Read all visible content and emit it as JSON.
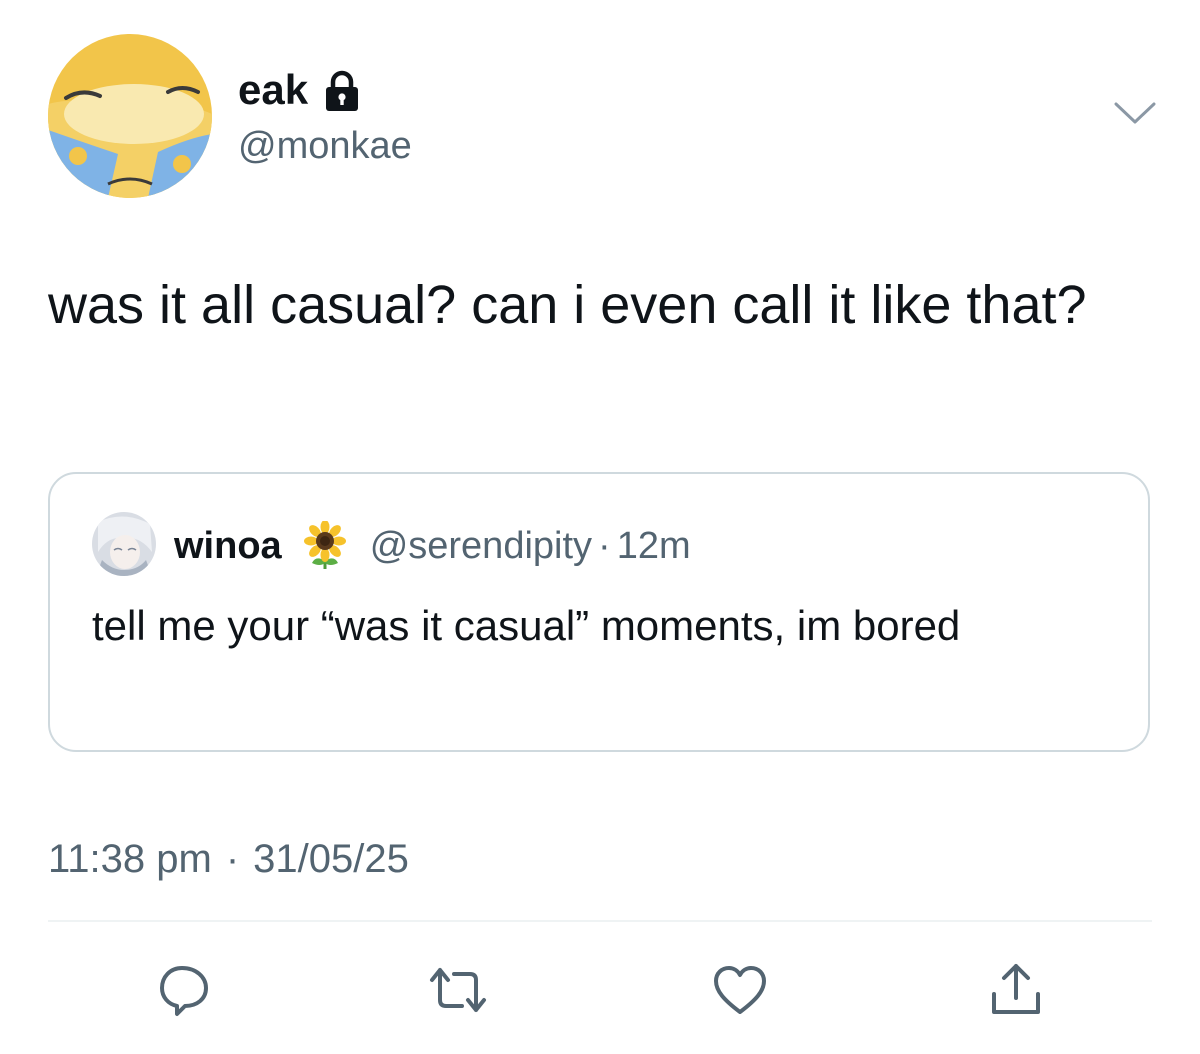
{
  "tweet": {
    "author": {
      "display_name": "eak",
      "handle": "@monkae",
      "protected_icon": "lock-icon",
      "avatar": "avatar-illustration"
    },
    "menu_icon": "chevron-down-icon",
    "text": "was it all casual? can i even call it like that?",
    "quoted_tweet": {
      "display_name": "winoa",
      "name_emoji": "sunflower-icon",
      "handle": "@serendipity",
      "separator": "·",
      "time": "12m",
      "text": "tell me your “was it casual” moments, im bored"
    },
    "timestamp": {
      "time": "11:38 pm",
      "separator": "·",
      "date": "31/05/25"
    },
    "actions": [
      {
        "name": "reply",
        "icon": "reply-icon"
      },
      {
        "name": "retweet",
        "icon": "retweet-icon"
      },
      {
        "name": "like",
        "icon": "heart-icon"
      },
      {
        "name": "share",
        "icon": "share-icon"
      }
    ]
  },
  "colors": {
    "text_primary": "#0f1419",
    "text_secondary": "#536471",
    "border": "#cfd9de",
    "icon": "#536471"
  }
}
